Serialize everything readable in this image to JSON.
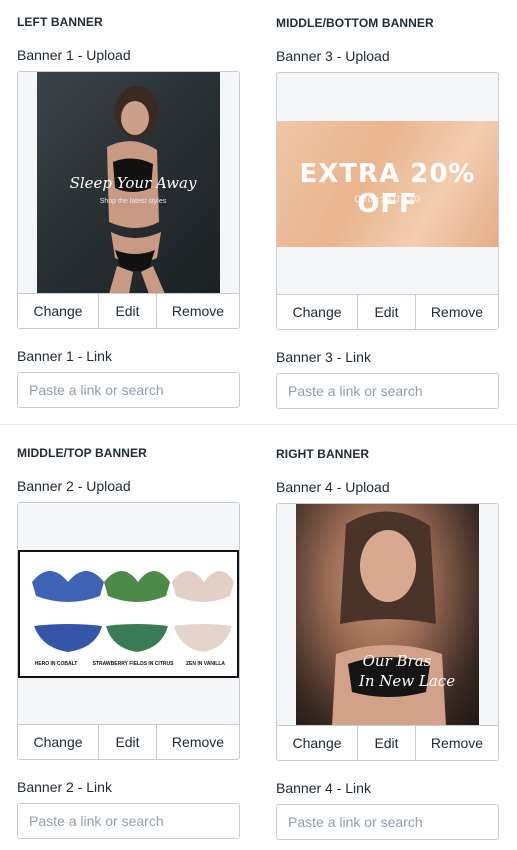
{
  "banners": {
    "left": {
      "heading": "LEFT BANNER",
      "upload_label": "Banner 1 - Upload",
      "art_text": [
        "Sleep Your Away",
        "Shop the latest styles"
      ],
      "change": "Change",
      "edit": "Edit",
      "remove": "Remove",
      "link_label": "Banner 1 - Link",
      "link_placeholder": "Paste a link or search"
    },
    "middle_bottom": {
      "heading": "MIDDLE/BOTTOM BANNER",
      "upload_label": "Banner 3 - Upload",
      "art_text": [
        "EXTRA 20% OFF",
        "Code: AUG20"
      ],
      "change": "Change",
      "edit": "Edit",
      "remove": "Remove",
      "link_label": "Banner 3 - Link",
      "link_placeholder": "Paste a link or search"
    },
    "middle_top": {
      "heading": "MIDDLE/TOP BANNER",
      "upload_label": "Banner 2 - Upload",
      "art_text": [
        "HERO IN COBALT",
        "STRAWBERRY FIELDS IN CITRUS",
        "ZEN IN VANILLA"
      ],
      "change": "Change",
      "edit": "Edit",
      "remove": "Remove",
      "link_label": "Banner 2 - Link",
      "link_placeholder": "Paste a link or search"
    },
    "right": {
      "heading": "RIGHT BANNER",
      "upload_label": "Banner 4 - Upload",
      "art_text": [
        "Our Bras",
        "In New Lace"
      ],
      "change": "Change",
      "edit": "Edit",
      "remove": "Remove",
      "link_label": "Banner 4 - Link",
      "link_placeholder": "Paste a link or search"
    }
  },
  "colors": {
    "text": "#212b36",
    "border": "#c4cdd5",
    "preview_bg": "#f4f6f8",
    "placeholder": "#919eab"
  }
}
